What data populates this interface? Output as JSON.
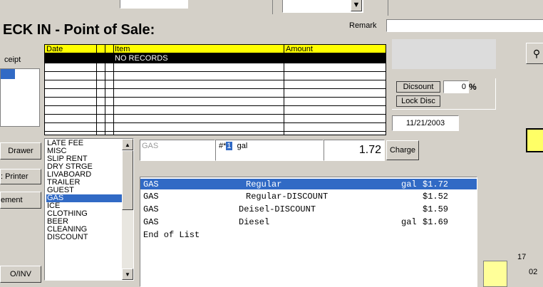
{
  "header": {
    "title": "ECK IN - Point of Sale:",
    "remark_label": "Remark",
    "remark_value": ""
  },
  "left": {
    "receipt_label": "ceipt",
    "drawer_button": "Drawer",
    "printer_button": ": Printer",
    "ement_button": "ement",
    "oinv_button": "O/INV"
  },
  "grid": {
    "col_date": "Date",
    "col_item": "Item",
    "col_amount": "Amount",
    "no_records": "NO RECORDS"
  },
  "right": {
    "discount_button": "Dicsount",
    "discount_value": "0",
    "percent_sign": "%",
    "lock_disc_button": "Lock Disc",
    "date_value": "11/21/2003",
    "num_17": "17",
    "num_02": "02"
  },
  "entry": {
    "item_name": "GAS",
    "qty_label": "#*",
    "qty_value": "1",
    "unit": "gal",
    "price": "1.72",
    "charge_button": "Charge"
  },
  "categories": [
    "LATE FEE",
    "MISC",
    "SLIP RENT",
    "DRY STRGE",
    "LIVABOARD",
    "TRAILER",
    "GUEST",
    "GAS",
    "ICE",
    "CLOTHING",
    "BEER",
    "CLEANING",
    "DISCOUNT"
  ],
  "selected_category": "GAS",
  "products": [
    {
      "cat": "GAS",
      "name": "Regular",
      "unit": "gal",
      "price": "$1.72",
      "selected": true
    },
    {
      "cat": "GAS",
      "name": "Regular-DISCOUNT",
      "unit": "",
      "price": "$1.52",
      "selected": false
    },
    {
      "cat": "GAS",
      "name": "Deisel-DISCOUNT",
      "unit": "",
      "price": "$1.59",
      "selected": false
    },
    {
      "cat": "GAS",
      "name": "Diesel",
      "unit": "gal",
      "price": "$1.69",
      "selected": false
    }
  ],
  "end_of_list": "End of List"
}
